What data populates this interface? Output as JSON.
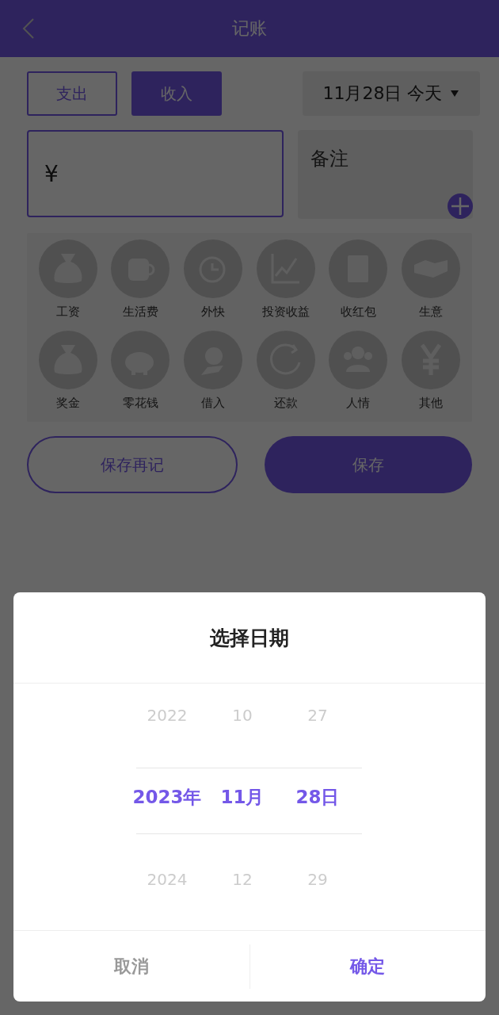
{
  "header": {
    "title": "记账"
  },
  "type_tabs": [
    {
      "label": "支出",
      "selected": false
    },
    {
      "label": "收入",
      "selected": true
    }
  ],
  "date_button": {
    "label": "11月28日 今天"
  },
  "amount_field": {
    "prefix": "¥"
  },
  "note_field": {
    "placeholder": "备注"
  },
  "categories": [
    {
      "label": "工资"
    },
    {
      "label": "生活费"
    },
    {
      "label": "外快"
    },
    {
      "label": "投资收益"
    },
    {
      "label": "收红包"
    },
    {
      "label": "生意"
    },
    {
      "label": "奖金"
    },
    {
      "label": "零花钱"
    },
    {
      "label": "借入"
    },
    {
      "label": "还款"
    },
    {
      "label": "人情"
    },
    {
      "label": "其他"
    }
  ],
  "buttons": {
    "save_again": "保存再记",
    "save": "保存"
  },
  "date_picker": {
    "title": "选择日期",
    "columns": [
      {
        "items": [
          {
            "label": "2022",
            "selected": false
          },
          {
            "label": "2023年",
            "selected": true
          },
          {
            "label": "2024",
            "selected": false
          }
        ]
      },
      {
        "items": [
          {
            "label": "10",
            "selected": false
          },
          {
            "label": "11月",
            "selected": true
          },
          {
            "label": "12",
            "selected": false
          }
        ]
      },
      {
        "items": [
          {
            "label": "27",
            "selected": false
          },
          {
            "label": "28日",
            "selected": true
          },
          {
            "label": "29",
            "selected": false
          }
        ]
      }
    ],
    "cancel": "取消",
    "confirm": "确定"
  }
}
